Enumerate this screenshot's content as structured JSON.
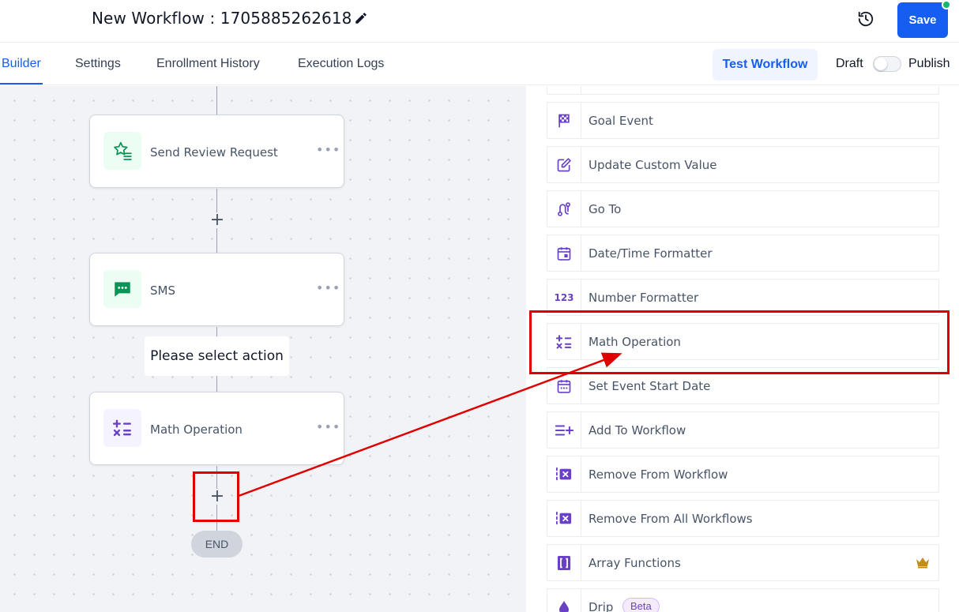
{
  "header": {
    "title": "New Workflow : 1705885262618",
    "save_label": "Save"
  },
  "tabs": {
    "items": [
      {
        "label": "Builder",
        "active": true
      },
      {
        "label": "Settings"
      },
      {
        "label": "Enrollment History"
      },
      {
        "label": "Execution Logs"
      }
    ],
    "test_label": "Test Workflow",
    "draft_label": "Draft",
    "publish_label": "Publish",
    "published": false
  },
  "canvas": {
    "nodes": [
      {
        "label": "Send Review Request",
        "icon": "star-list-icon"
      },
      {
        "label": "SMS",
        "icon": "chat-icon"
      },
      {
        "label": "Math Operation",
        "icon": "math-icon"
      }
    ],
    "tooltip": "Please select action",
    "end_label": "END",
    "menu_glyph": "•••",
    "plus_glyph": "+"
  },
  "actions": {
    "items": [
      {
        "label": "Goal Event",
        "icon": "checkered-flag-icon"
      },
      {
        "label": "Update Custom Value",
        "icon": "edit-square-icon"
      },
      {
        "label": "Go To",
        "icon": "route-icon"
      },
      {
        "label": "Date/Time Formatter",
        "icon": "calendar-icon"
      },
      {
        "label": "Number Formatter",
        "icon": "number-123-icon",
        "icon_text": "123"
      },
      {
        "label": "Math Operation",
        "icon": "math-icon"
      },
      {
        "label": "Set Event Start Date",
        "icon": "calendar-event-icon"
      },
      {
        "label": "Add To Workflow",
        "icon": "list-add-icon"
      },
      {
        "label": "Remove From Workflow",
        "icon": "remove-box-icon"
      },
      {
        "label": "Remove From All Workflows",
        "icon": "remove-box-icon"
      },
      {
        "label": "Array Functions",
        "icon": "brackets-icon",
        "premium": true
      },
      {
        "label": "Drip",
        "icon": "drop-icon",
        "badge": "Beta"
      }
    ]
  },
  "colors": {
    "primary": "#155eef",
    "icon_purple": "#6941c6",
    "icon_green": "#079455",
    "highlight_red": "#e00000"
  }
}
